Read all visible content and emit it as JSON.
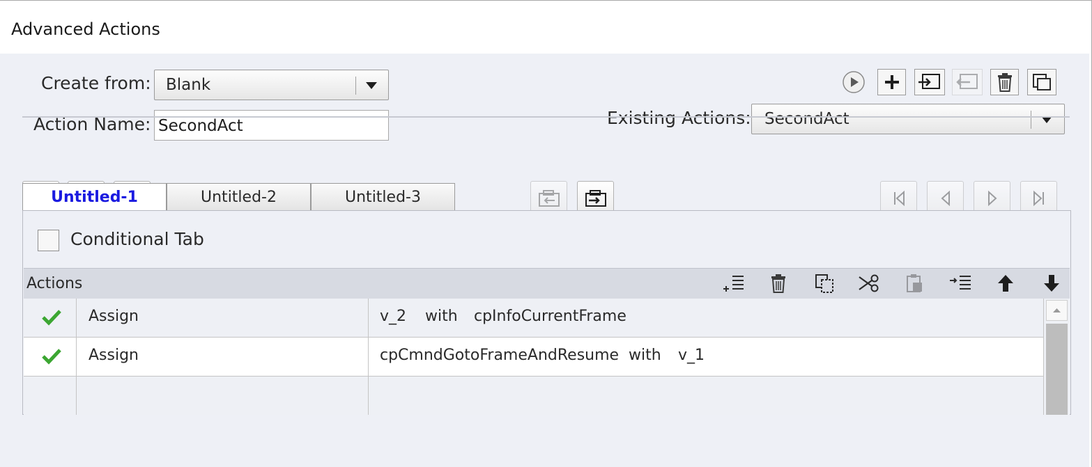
{
  "window": {
    "title": "Advanced Actions"
  },
  "form": {
    "create_from_label": "Create from:",
    "create_from_value": "Blank",
    "action_name_label": "Action Name:",
    "action_name_value": "SecondAct",
    "existing_actions_label": "Existing Actions:",
    "existing_actions_value": "SecondAct"
  },
  "top_icons": [
    "preview-play-icon",
    "create-new-action-icon",
    "import-action-icon",
    "export-action-icon",
    "delete-action-icon",
    "duplicate-action-icon"
  ],
  "toolbar": {
    "left": [
      "add-decision-icon",
      "delete-decision-icon",
      "duplicate-decision-icon"
    ],
    "center": [
      "import-icon",
      "export-icon"
    ],
    "right": [
      "first-icon",
      "previous-icon",
      "next-icon",
      "last-icon"
    ]
  },
  "tabs": [
    {
      "label": "Untitled-1",
      "active": true
    },
    {
      "label": "Untitled-2",
      "active": false
    },
    {
      "label": "Untitled-3",
      "active": false
    }
  ],
  "conditional_tab_label": "Conditional Tab",
  "actions_panel": {
    "title": "Actions",
    "icons": [
      "add-row-icon",
      "delete-row-icon",
      "copy-row-icon",
      "cut-row-icon",
      "paste-row-icon",
      "insert-row-icon",
      "move-up-icon",
      "move-down-icon"
    ],
    "rows": [
      {
        "status": "check-icon",
        "action": "Assign",
        "target": "v_2",
        "with_label": "with",
        "source": "cpInfoCurrentFrame"
      },
      {
        "status": "check-icon",
        "action": "Assign",
        "target": "cpCmndGotoFrameAndResume",
        "with_label": "with",
        "source": "v_1"
      }
    ]
  },
  "colors": {
    "active_tab": "#1a1ae0",
    "check": "#3ca632",
    "panel_bg": "#eef0f6"
  }
}
